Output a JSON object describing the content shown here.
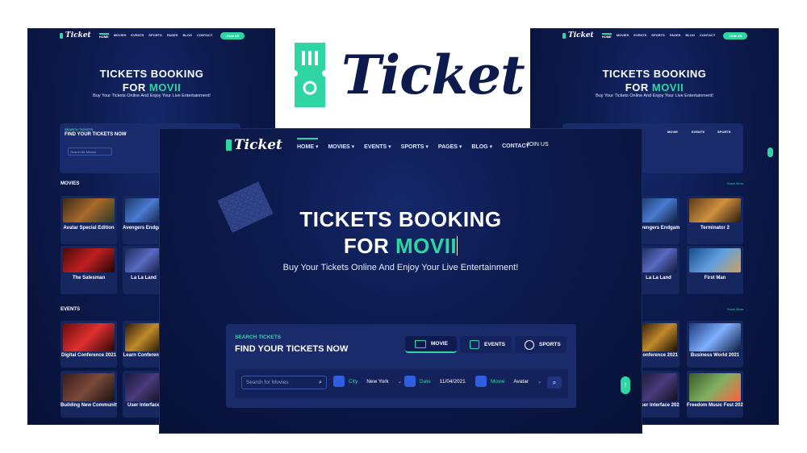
{
  "brand": {
    "name": "Ticket",
    "accent_color": "#2fd6a4",
    "dark_color": "#0c1a4d"
  },
  "nav": {
    "items": [
      "HOME",
      "MOVIES",
      "EVENTS",
      "SPORTS",
      "PAGES",
      "BLOG",
      "CONTACT"
    ],
    "join_label": "JOIN US"
  },
  "hero": {
    "title_line1": "TICKETS BOOKING",
    "title_line2_prefix": "FOR ",
    "title_line2_accent": "MOVII",
    "subtitle": "Buy Your Tickets Online And Enjoy Your Live Entertainment!"
  },
  "search": {
    "eyebrow": "SEARCH TICKETS",
    "heading": "FIND YOUR TICKETS NOW",
    "tabs": [
      "MOVIE",
      "EVENTS",
      "SPORTS"
    ],
    "input_placeholder": "Search for Movies",
    "city_label": "City",
    "city_value": "New York",
    "date_label": "Date",
    "date_value": "11/04/2021",
    "movie_label": "Movie",
    "movie_value": "Avatar"
  },
  "movies": {
    "label": "MOVIES",
    "more": "Show More",
    "left_titles": [
      "Avatar Special Edition",
      "Avengers Endgame",
      "The Salesman",
      "La La Land"
    ],
    "right_titles": [
      "Avengers Endgame",
      "Terminator 2",
      "La La Land",
      "First Man"
    ]
  },
  "events": {
    "label": "EVENTS",
    "more": "Show More",
    "left_titles": [
      "Digital Conference 2021",
      "Learn Conference",
      "Building New Community",
      "User Interface"
    ],
    "right_titles": [
      "Conference 2021",
      "Business World 2021",
      "User Interface 2021",
      "Freedom Music Fest 2021"
    ]
  },
  "icons": [
    "ticket-icon",
    "search-icon",
    "city-icon",
    "calendar-icon",
    "film-icon",
    "sports-icon",
    "chevron-down-icon",
    "arrow-up-icon"
  ]
}
